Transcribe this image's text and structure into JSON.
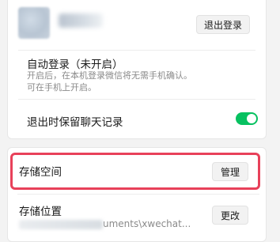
{
  "account": {
    "logout_button": "退出登录"
  },
  "auto_login": {
    "title": "自动登录（未开启）",
    "desc_line1": "开启后，在本机登录微信将无需手机确认。",
    "desc_line2": "可在手机上开启。"
  },
  "keep_chat": {
    "title": "退出时保留聊天记录",
    "toggle_on": true
  },
  "storage": {
    "title": "存储空间",
    "manage_button": "管理"
  },
  "storage_location": {
    "title": "存储位置",
    "path_visible": "uments\\xwechat...",
    "change_button": "更改"
  },
  "colors": {
    "toggle_on": "#07c160",
    "highlight_border": "#e8415a"
  }
}
